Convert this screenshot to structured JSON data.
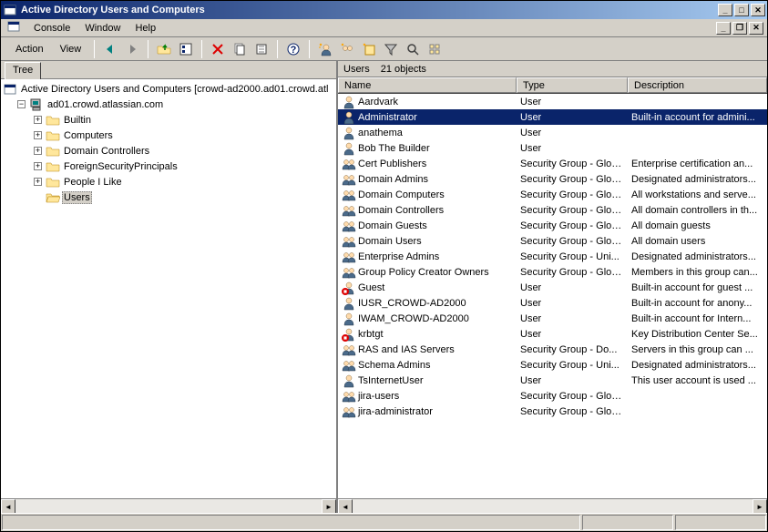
{
  "title": "Active Directory Users and Computers",
  "menu": {
    "console": "Console",
    "window": "Window",
    "help": "Help"
  },
  "toolbar": {
    "action": "Action",
    "view": "View"
  },
  "tree_tab": "Tree",
  "tree": {
    "root": "Active Directory Users and Computers [crowd-ad2000.ad01.crowd.atl",
    "domain": "ad01.crowd.atlassian.com",
    "children": [
      {
        "label": "Builtin"
      },
      {
        "label": "Computers"
      },
      {
        "label": "Domain Controllers"
      },
      {
        "label": "ForeignSecurityPrincipals"
      },
      {
        "label": "People I Like"
      },
      {
        "label": "Users"
      }
    ]
  },
  "list": {
    "header": "Users",
    "count": "21 objects",
    "columns": {
      "name": "Name",
      "type": "Type",
      "desc": "Description"
    },
    "rows": [
      {
        "name": "Aardvark",
        "type": "User",
        "desc": "",
        "icon": "user"
      },
      {
        "name": "Administrator",
        "type": "User",
        "desc": "Built-in account for admini...",
        "icon": "user",
        "selected": true
      },
      {
        "name": "anathema",
        "type": "User",
        "desc": "",
        "icon": "user"
      },
      {
        "name": "Bob The Builder",
        "type": "User",
        "desc": "",
        "icon": "user"
      },
      {
        "name": "Cert Publishers",
        "type": "Security Group - Global",
        "desc": "Enterprise certification an...",
        "icon": "group"
      },
      {
        "name": "Domain Admins",
        "type": "Security Group - Global",
        "desc": "Designated administrators...",
        "icon": "group"
      },
      {
        "name": "Domain Computers",
        "type": "Security Group - Global",
        "desc": "All workstations and serve...",
        "icon": "group"
      },
      {
        "name": "Domain Controllers",
        "type": "Security Group - Global",
        "desc": "All domain controllers in th...",
        "icon": "group"
      },
      {
        "name": "Domain Guests",
        "type": "Security Group - Global",
        "desc": "All domain guests",
        "icon": "group"
      },
      {
        "name": "Domain Users",
        "type": "Security Group - Global",
        "desc": "All domain users",
        "icon": "group"
      },
      {
        "name": "Enterprise Admins",
        "type": "Security Group - Uni...",
        "desc": "Designated administrators...",
        "icon": "group"
      },
      {
        "name": "Group Policy Creator Owners",
        "type": "Security Group - Global",
        "desc": "Members in this group can...",
        "icon": "group"
      },
      {
        "name": "Guest",
        "type": "User",
        "desc": "Built-in account for guest ...",
        "icon": "user-disabled"
      },
      {
        "name": "IUSR_CROWD-AD2000",
        "type": "User",
        "desc": "Built-in account for anony...",
        "icon": "user"
      },
      {
        "name": "IWAM_CROWD-AD2000",
        "type": "User",
        "desc": "Built-in account for Intern...",
        "icon": "user"
      },
      {
        "name": "krbtgt",
        "type": "User",
        "desc": "Key Distribution Center Se...",
        "icon": "user-disabled"
      },
      {
        "name": "RAS and IAS Servers",
        "type": "Security Group - Do...",
        "desc": "Servers in this group can ...",
        "icon": "group"
      },
      {
        "name": "Schema Admins",
        "type": "Security Group - Uni...",
        "desc": "Designated administrators...",
        "icon": "group"
      },
      {
        "name": "TsInternetUser",
        "type": "User",
        "desc": "This user account is used ...",
        "icon": "user"
      },
      {
        "name": "jira-users",
        "type": "Security Group - Global",
        "desc": "",
        "icon": "group"
      },
      {
        "name": "jira-administrator",
        "type": "Security Group - Global",
        "desc": "",
        "icon": "group"
      }
    ]
  }
}
